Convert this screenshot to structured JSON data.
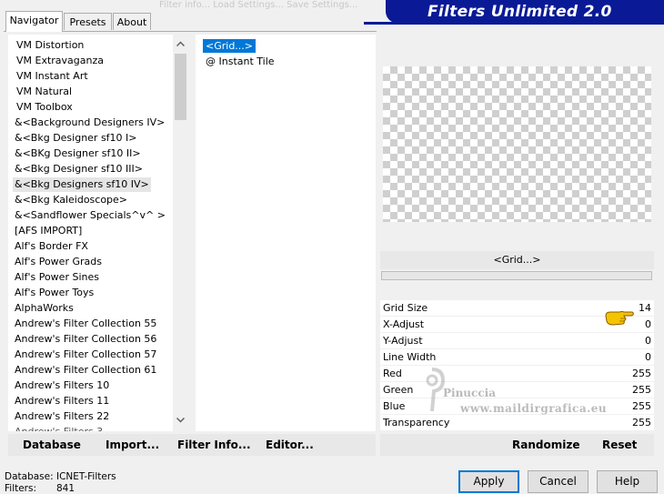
{
  "window": {
    "title": "Filters Unlimited 2.0",
    "faint_header": "Filter info...   Load Settings...   Save Settings..."
  },
  "tabs": [
    {
      "label": "Navigator",
      "active": true
    },
    {
      "label": "Presets",
      "active": false
    },
    {
      "label": "About",
      "active": false
    }
  ],
  "categories": [
    "VM Distortion",
    "VM Extravaganza",
    "VM Instant Art",
    "VM Natural",
    "VM Toolbox",
    "&<Background Designers IV>",
    "&<Bkg Designer sf10 I>",
    "&<BKg Designer sf10 II>",
    "&<Bkg Designer sf10 III>",
    "&<Bkg Designers sf10 IV>",
    "&<Bkg Kaleidoscope>",
    "&<Sandflower Specials^v^ >",
    "[AFS IMPORT]",
    "Alf's Border FX",
    "Alf's Power Grads",
    "Alf's Power Sines",
    "Alf's Power Toys",
    "AlphaWorks",
    "Andrew's Filter Collection 55",
    "Andrew's Filter Collection 56",
    "Andrew's Filter Collection 57",
    "Andrew's Filter Collection 61",
    "Andrew's Filters 10",
    "Andrew's Filters 11",
    "Andrew's Filters 22"
  ],
  "selected_category": "&<Bkg Designers sf10 IV>",
  "filters": [
    "<Grid...>",
    "@ Instant Tile"
  ],
  "selected_filter": "<Grid...>",
  "preview": {
    "filter_name": "<Grid...>"
  },
  "params": [
    {
      "label": "Grid Size",
      "value": "14"
    },
    {
      "label": "X-Adjust",
      "value": "0"
    },
    {
      "label": "Y-Adjust",
      "value": "0"
    },
    {
      "label": "Line Width",
      "value": "0"
    },
    {
      "label": "Red",
      "value": "255"
    },
    {
      "label": "Green",
      "value": "255"
    },
    {
      "label": "Blue",
      "value": "255"
    },
    {
      "label": "Transparency",
      "value": "255"
    }
  ],
  "watermark": {
    "name": "Pinuccia",
    "site": "www.maildirgrafica.eu"
  },
  "left_buttons": {
    "database": "Database",
    "import": "Import...",
    "filter_info": "Filter Info...",
    "editor": "Editor..."
  },
  "right_buttons": {
    "randomize": "Randomize",
    "reset": "Reset"
  },
  "status": {
    "database_label": "Database:",
    "database_value": "ICNET-Filters",
    "filters_label": "Filters:",
    "filters_value": "841"
  },
  "dialog_buttons": {
    "apply": "Apply",
    "cancel": "Cancel",
    "help": "Help"
  },
  "colors": {
    "banner": "#0a1a96",
    "selection": "#0078d7",
    "pointer_hand": "#f5c400"
  },
  "icons": {
    "scroll_up": "chevron-up-icon",
    "scroll_down": "chevron-down-icon",
    "pointer": "pointing-hand-icon"
  }
}
